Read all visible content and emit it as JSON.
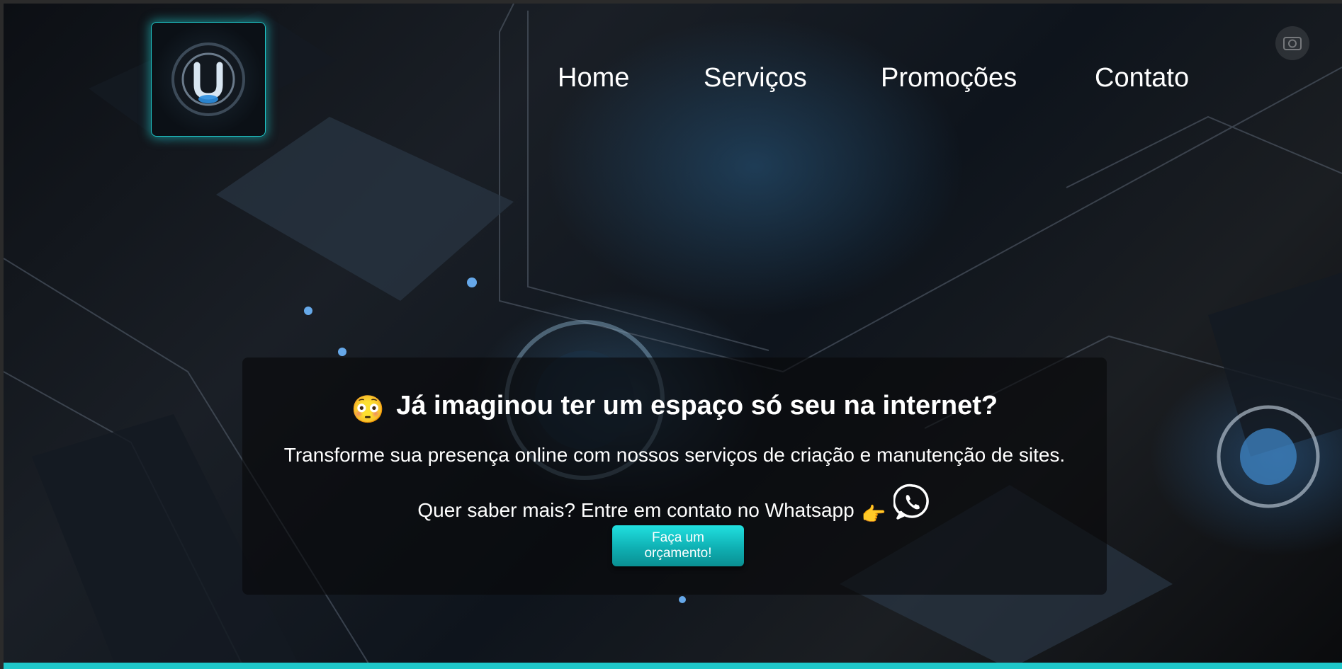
{
  "nav": {
    "items": [
      {
        "label": "Home"
      },
      {
        "label": "Serviços"
      },
      {
        "label": "Promoções"
      },
      {
        "label": "Contato"
      }
    ]
  },
  "hero": {
    "title": "Já imaginou ter um espaço só seu na internet?",
    "title_emoji": "😳",
    "subtitle": "Transforme sua presença online com nossos serviços de criação e manutenção de sites.",
    "cta_text": "Quer saber mais? Entre em contato no Whatsapp",
    "cta_emoji": "👉",
    "button_label": "Faça um orçamento!"
  },
  "icons": {
    "logo": "logo-u-icon",
    "whatsapp": "whatsapp-icon",
    "camera": "camera-icon"
  },
  "colors": {
    "accent": "#1fc7c9",
    "button": "#12c4c6",
    "text": "#ffffff",
    "overlay": "rgba(8,8,10,0.62)"
  }
}
